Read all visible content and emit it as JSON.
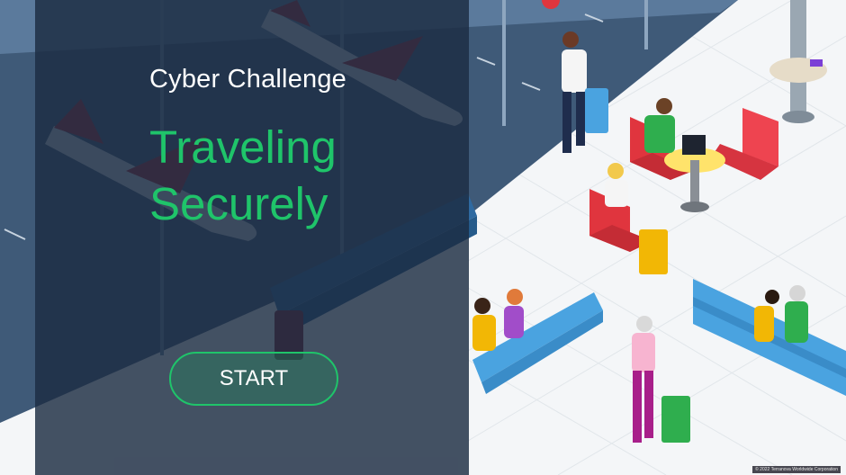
{
  "intro": {
    "kicker": "Cyber Challenge",
    "title_line1": "Traveling",
    "title_line2": "Securely",
    "start_label": "START"
  },
  "footer": {
    "copyright": "© 2022 Terranova Worldwide Corporation"
  },
  "colors": {
    "accent": "#1fc46a",
    "panel": "#1c2c42",
    "floor": "#f4f6f8",
    "window": "#3f5a78",
    "seat_blue": "#4aa3e0",
    "chair_red": "#e63b46"
  }
}
